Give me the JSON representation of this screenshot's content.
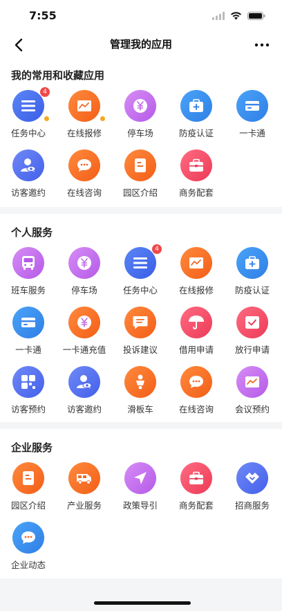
{
  "status": {
    "time": "7:55"
  },
  "nav": {
    "title": "管理我的应用"
  },
  "sections": [
    {
      "title": "我的常用和收藏应用",
      "apps": [
        {
          "label": "任务中心",
          "icon": "list-icon",
          "badge": "4",
          "dot": true,
          "color": "g-blue"
        },
        {
          "label": "在线报修",
          "icon": "chart-icon",
          "dot": true,
          "color": "g-orange"
        },
        {
          "label": "停车场",
          "icon": "yen-icon",
          "color": "g-purple"
        },
        {
          "label": "防疫认证",
          "icon": "medical-kit-icon",
          "color": "g-lblue"
        },
        {
          "label": "一卡通",
          "icon": "card-icon",
          "color": "g-lblue"
        },
        {
          "label": "访客邀约",
          "icon": "visitor-icon",
          "color": "g-indigo"
        },
        {
          "label": "在线咨询",
          "icon": "chat-icon",
          "color": "g-orange"
        },
        {
          "label": "园区介绍",
          "icon": "document-icon",
          "color": "g-orange"
        },
        {
          "label": "商务配套",
          "icon": "briefcase-icon",
          "color": "g-pink"
        }
      ]
    },
    {
      "title": "个人服务",
      "apps": [
        {
          "label": "班车服务",
          "icon": "bus-icon",
          "color": "g-purple"
        },
        {
          "label": "停车场",
          "icon": "yen-icon",
          "color": "g-purple"
        },
        {
          "label": "任务中心",
          "icon": "list-icon",
          "badge": "4",
          "color": "g-blue"
        },
        {
          "label": "在线报修",
          "icon": "chart-icon",
          "color": "g-orange"
        },
        {
          "label": "防疫认证",
          "icon": "medical-kit-icon",
          "color": "g-lblue"
        },
        {
          "label": "一卡通",
          "icon": "card-icon",
          "color": "g-lblue"
        },
        {
          "label": "一卡通充值",
          "icon": "yen-icon",
          "color": "g-orange"
        },
        {
          "label": "投诉建议",
          "icon": "comment-icon",
          "color": "g-orange"
        },
        {
          "label": "借用申请",
          "icon": "umbrella-icon",
          "color": "g-pink"
        },
        {
          "label": "放行申请",
          "icon": "check-icon",
          "color": "g-pink"
        },
        {
          "label": "访客预约",
          "icon": "grid-icon",
          "color": "g-indigo"
        },
        {
          "label": "访客邀约",
          "icon": "visitor-icon",
          "color": "g-indigo"
        },
        {
          "label": "滑板车",
          "icon": "scooter-icon",
          "color": "g-orange"
        },
        {
          "label": "在线咨询",
          "icon": "chat-icon",
          "color": "g-orange"
        },
        {
          "label": "会议预约",
          "icon": "chart-icon",
          "color": "g-purple"
        }
      ]
    },
    {
      "title": "企业服务",
      "apps": [
        {
          "label": "园区介绍",
          "icon": "document-icon",
          "color": "g-orange"
        },
        {
          "label": "产业服务",
          "icon": "van-icon",
          "color": "g-orange"
        },
        {
          "label": "政策导引",
          "icon": "navigation-icon",
          "color": "g-purple"
        },
        {
          "label": "商务配套",
          "icon": "briefcase-icon",
          "color": "g-pink"
        },
        {
          "label": "招商服务",
          "icon": "handshake-icon",
          "color": "g-indigo"
        },
        {
          "label": "企业动态",
          "icon": "chat-icon",
          "color": "g-lblue"
        }
      ]
    }
  ]
}
